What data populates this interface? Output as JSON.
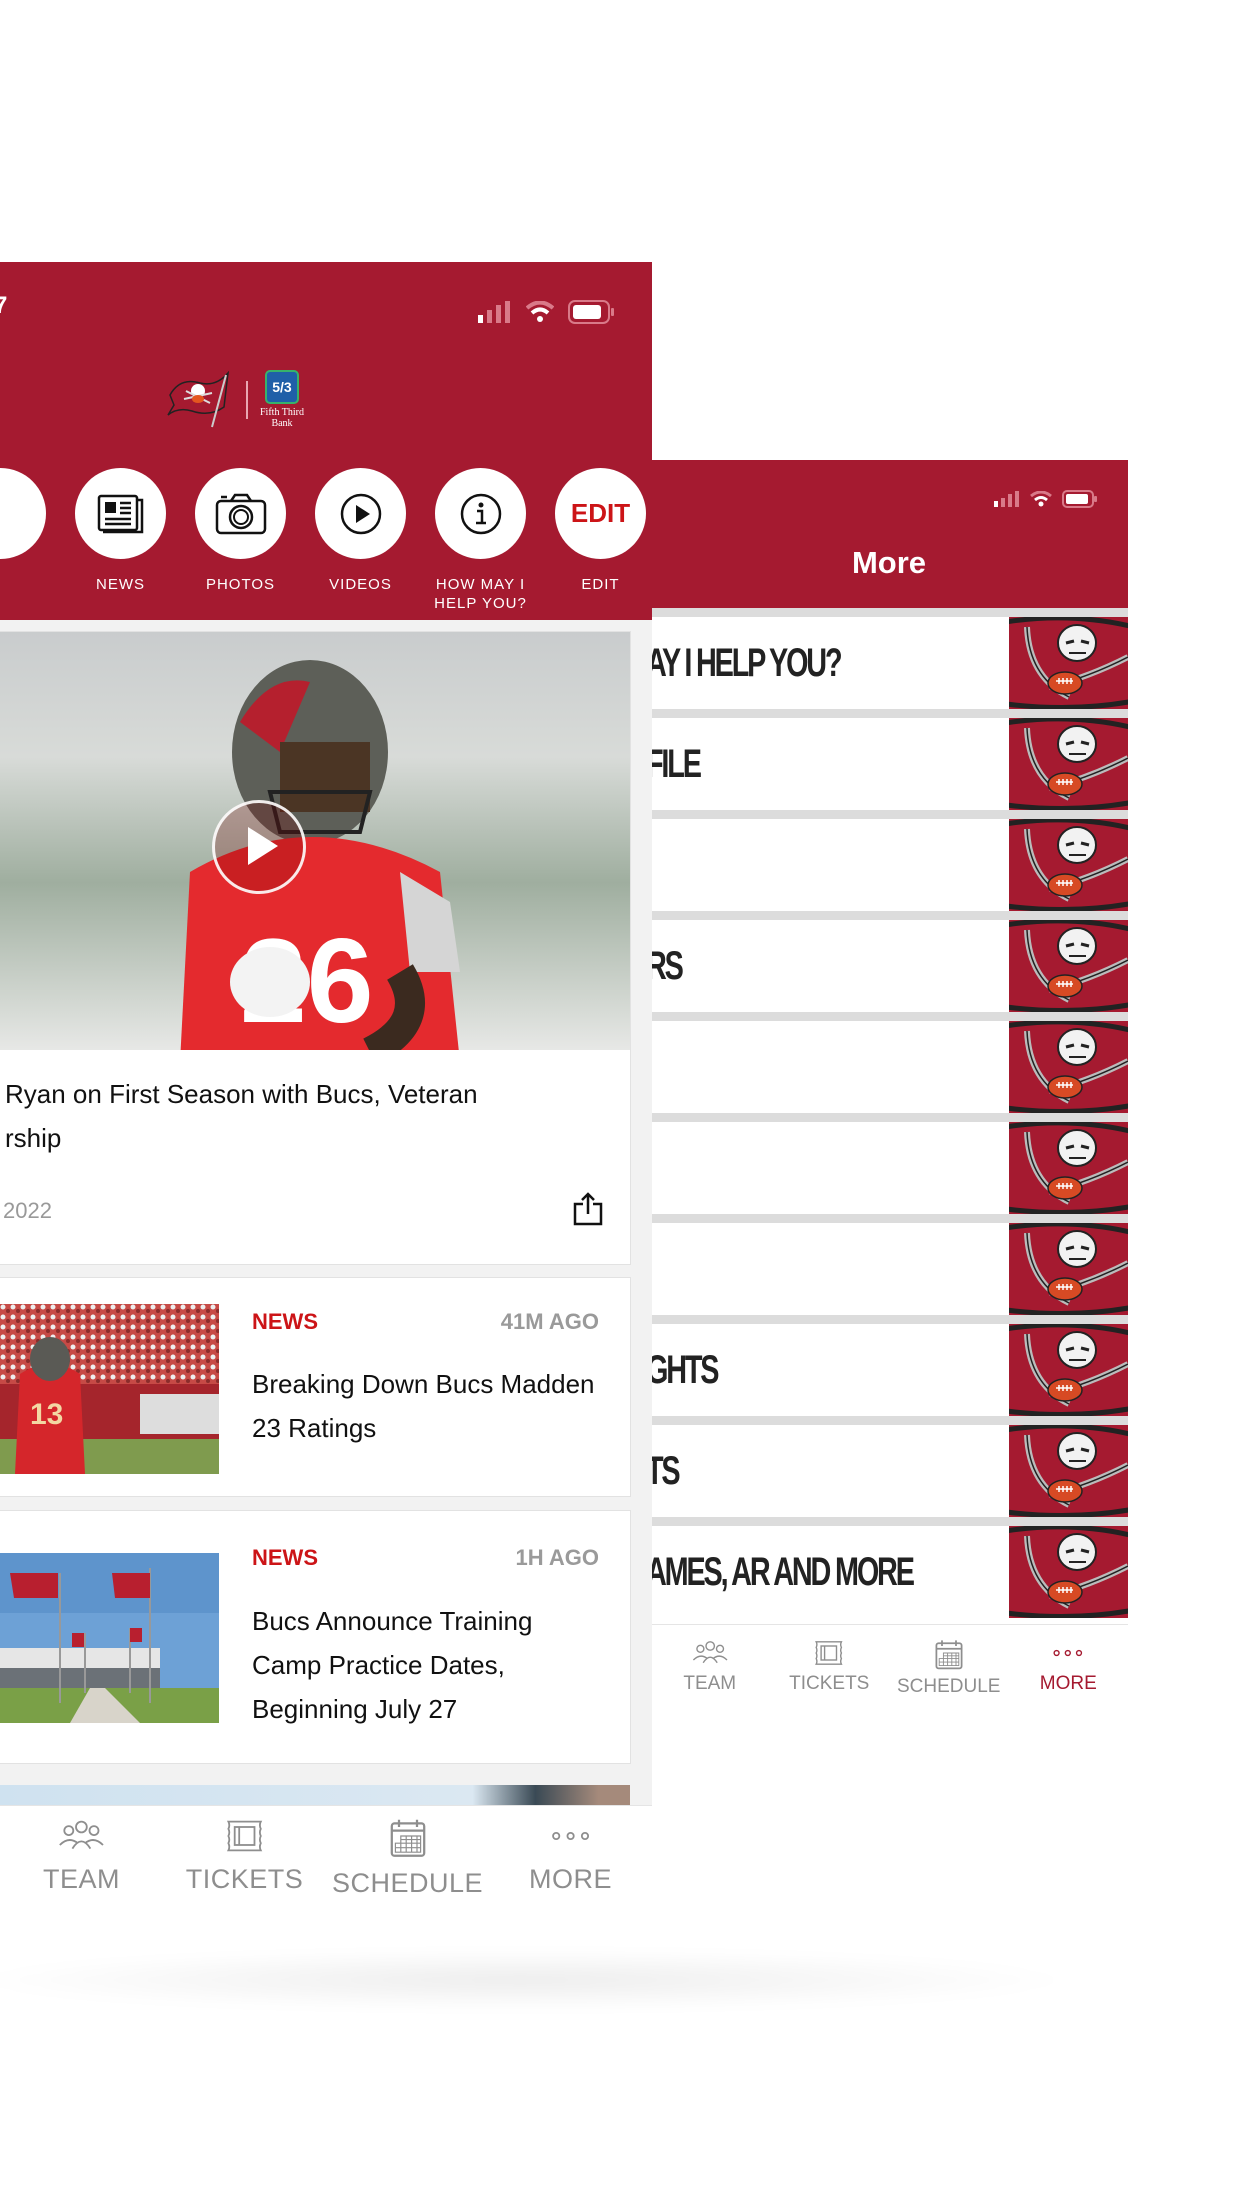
{
  "colors": {
    "brand_red": "#a51a30",
    "accent_red": "#cc1417",
    "muted_gray": "#8e8e8e"
  },
  "left_screen": {
    "status_bar": {
      "time_fragment": "7",
      "icons": [
        "signal-icon",
        "wifi-icon",
        "battery-icon"
      ]
    },
    "header": {
      "team_logo": "buccaneers-flag-logo",
      "sponsor": {
        "badge": "5/3",
        "line1": "Fifth Third",
        "line2": "Bank"
      }
    },
    "quick_actions": [
      {
        "label": "NEWS",
        "icon": "newspaper-icon"
      },
      {
        "label": "PHOTOS",
        "icon": "camera-icon"
      },
      {
        "label": "VIDEOS",
        "icon": "play-circle-icon"
      },
      {
        "label": "HOW MAY I\nHELP YOU?",
        "icon": "info-icon",
        "line1": "HOW MAY I",
        "line2": "HELP YOU?"
      },
      {
        "label": "EDIT",
        "icon_text": "EDIT"
      }
    ],
    "hero_story": {
      "title_line1": "Ryan on First Season with Bucs, Veteran",
      "title_line2": "rship",
      "date_fragment": "2022"
    },
    "news_items": [
      {
        "tag": "NEWS",
        "time": "41M AGO",
        "title": "Breaking Down Bucs Madden 23 Ratings"
      },
      {
        "tag": "NEWS",
        "time": "1H AGO",
        "title": "Bucs Announce Training Camp Practice Dates, Beginning July 27"
      }
    ],
    "tabbar": [
      {
        "label": "TEAM",
        "icon": "team-icon"
      },
      {
        "label": "TICKETS",
        "icon": "ticket-icon"
      },
      {
        "label": "SCHEDULE",
        "icon": "calendar-icon"
      },
      {
        "label": "MORE",
        "icon": "more-dots-icon"
      }
    ]
  },
  "right_screen": {
    "title": "More",
    "menu_items": [
      {
        "label": "AY I HELP YOU?"
      },
      {
        "label": "FILE"
      },
      {
        "label": ""
      },
      {
        "label": "RS"
      },
      {
        "label": ""
      },
      {
        "label": ""
      },
      {
        "label": ""
      },
      {
        "label": "GHTS"
      },
      {
        "label": "TS"
      },
      {
        "label": "AMES, AR AND MORE"
      }
    ],
    "tabbar": [
      {
        "label": "TEAM",
        "icon": "team-icon"
      },
      {
        "label": "TICKETS",
        "icon": "ticket-icon"
      },
      {
        "label": "SCHEDULE",
        "icon": "calendar-icon"
      },
      {
        "label": "MORE",
        "icon": "more-dots-icon",
        "active": true
      }
    ]
  }
}
